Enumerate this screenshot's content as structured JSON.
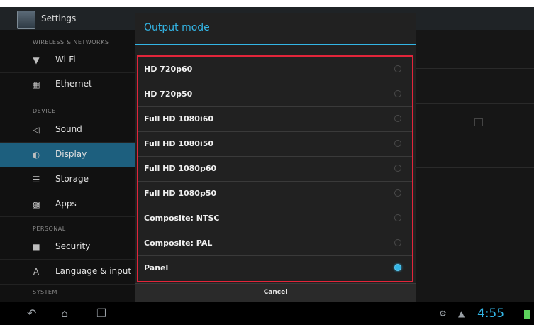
{
  "app": {
    "title": "Settings"
  },
  "sidebar": {
    "headers": [
      "WIRELESS & NETWORKS",
      "DEVICE",
      "PERSONAL",
      "SYSTEM"
    ],
    "items": [
      {
        "label": "Wi-Fi",
        "icon": "wifi-icon"
      },
      {
        "label": "Ethernet",
        "icon": "ethernet-icon"
      },
      {
        "label": "Sound",
        "icon": "sound-icon"
      },
      {
        "label": "Display",
        "icon": "display-icon",
        "selected": true
      },
      {
        "label": "Storage",
        "icon": "storage-icon"
      },
      {
        "label": "Apps",
        "icon": "apps-icon"
      },
      {
        "label": "Security",
        "icon": "lock-icon"
      },
      {
        "label": "Language & input",
        "icon": "language-icon"
      }
    ]
  },
  "dialog": {
    "title": "Output mode",
    "options": [
      {
        "label": "HD 720p60",
        "selected": false
      },
      {
        "label": "HD 720p50",
        "selected": false
      },
      {
        "label": "Full HD 1080i60",
        "selected": false
      },
      {
        "label": "Full HD 1080i50",
        "selected": false
      },
      {
        "label": "Full HD 1080p60",
        "selected": false
      },
      {
        "label": "Full HD 1080p50",
        "selected": false
      },
      {
        "label": "Composite: NTSC",
        "selected": false
      },
      {
        "label": "Composite: PAL",
        "selected": false
      },
      {
        "label": "Panel",
        "selected": true
      }
    ],
    "cancel_label": "Cancel"
  },
  "status": {
    "time": "4:55"
  },
  "colors": {
    "accent": "#33b5e5",
    "highlight_border": "#e2253a",
    "selected_row": "#1d5f7e"
  }
}
